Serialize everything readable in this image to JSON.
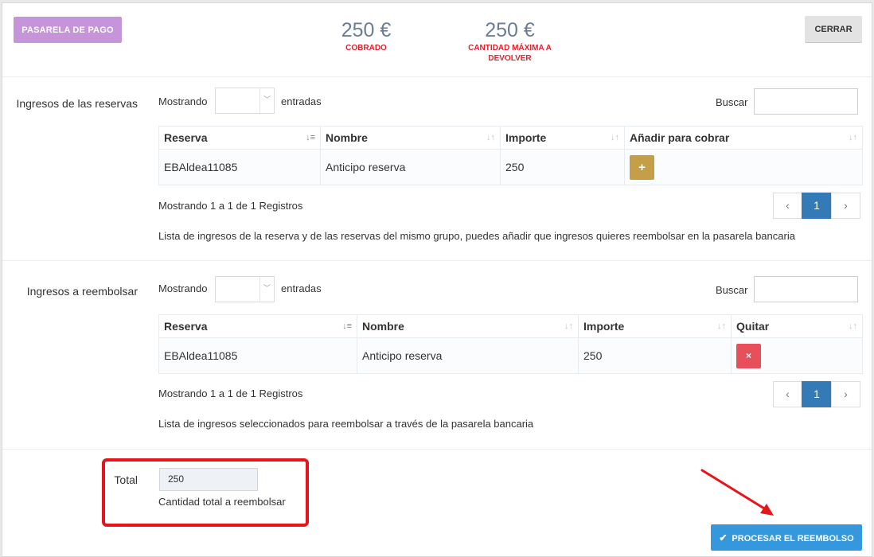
{
  "header": {
    "pasarela_label": "PASARELA DE PAGO",
    "close_label": "CERRAR",
    "cobrado": {
      "amount": "250 €",
      "label": "COBRADO"
    },
    "max_devolver": {
      "amount": "250 €",
      "label_line1": "CANTIDAD MÁXIMA A",
      "label_line2": "DEVOLVER"
    }
  },
  "ingresos_reservas": {
    "section_label": "Ingresos de las reservas",
    "showing_label": "Mostrando",
    "entries_label": "entradas",
    "search_label": "Buscar",
    "search_value": "",
    "columns": [
      "Reserva",
      "Nombre",
      "Importe",
      "Añadir para cobrar"
    ],
    "rows": [
      {
        "reserva": "EBAldea11085",
        "nombre": "Anticipo reserva",
        "importe": "250",
        "action": "+"
      }
    ],
    "info": "Mostrando 1 a 1 de 1 Registros",
    "pagination": {
      "prev": "‹",
      "current": "1",
      "next": "›"
    },
    "help": "Lista de ingresos de la reserva y de las reservas del mismo grupo, puedes añadir que ingresos quieres reembolsar en la pasarela bancaria"
  },
  "ingresos_reembolsar": {
    "section_label": "Ingresos a reembolsar",
    "showing_label": "Mostrando",
    "entries_label": "entradas",
    "search_label": "Buscar",
    "search_value": "",
    "columns": [
      "Reserva",
      "Nombre",
      "Importe",
      "Quitar"
    ],
    "rows": [
      {
        "reserva": "EBAldea11085",
        "nombre": "Anticipo reserva",
        "importe": "250",
        "action": "×"
      }
    ],
    "info": "Mostrando 1 a 1 de 1 Registros",
    "pagination": {
      "prev": "‹",
      "current": "1",
      "next": "›"
    },
    "help": "Lista de ingresos seleccionados para reembolsar a través de la pasarela bancaria"
  },
  "total": {
    "label": "Total",
    "value": "250",
    "help": "Cantidad total a reembolsar"
  },
  "footer": {
    "process_label": "PROCESAR EL REEMBOLSO",
    "process_icon": "check-icon"
  },
  "colors": {
    "pasarela_button": "#c695d9",
    "amount_text": "#6b7d95",
    "alert_red": "#e7202a",
    "add_button": "#c49f47",
    "remove_button": "#e7505a",
    "primary_blue": "#3598dc",
    "pager_active": "#337ab7",
    "annotation_red": "#e8141b"
  }
}
